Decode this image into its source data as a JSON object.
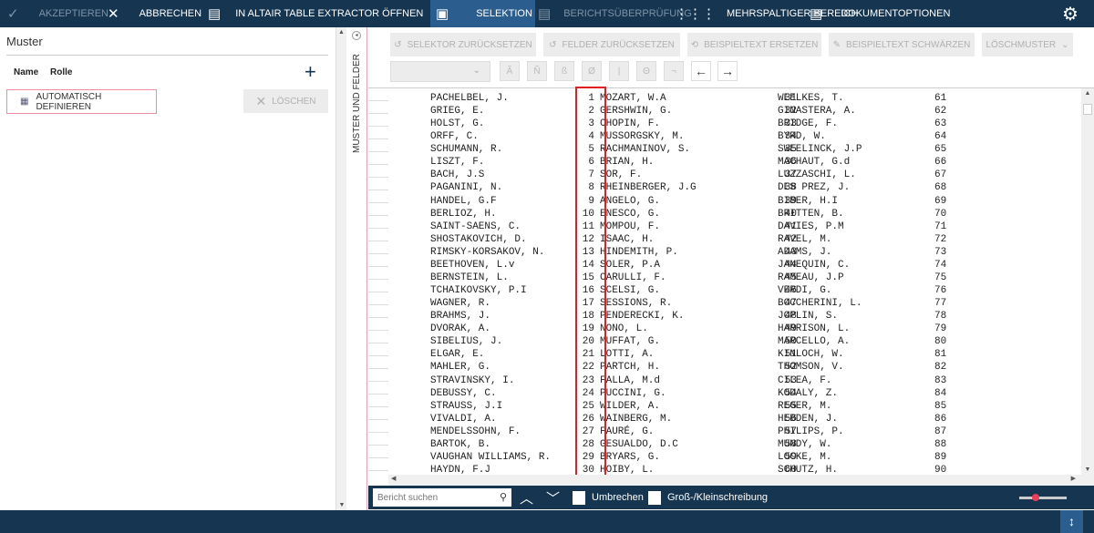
{
  "topbar": {
    "accept": "AKZEPTIEREN",
    "cancel": "ABBRECHEN",
    "open_extractor": "IN ALTAIR TABLE EXTRACTOR ÖFFNEN",
    "selection": "SELEKTION",
    "report_check": "BERICHTSÜBERPRÜFUNG",
    "multicolumn": "MEHRSPALTIGER BEREICH",
    "doc_options": "DOKUMENTOPTIONEN"
  },
  "left": {
    "title": "Muster",
    "col_name": "Name",
    "col_role": "Rolle",
    "auto_define": "AUTOMATISCH DEFINIEREN",
    "delete": "LÖSCHEN"
  },
  "vertical_tab": "MUSTER UND FELDER",
  "toolbar": {
    "reset_selector": "SELEKTOR ZURÜCKSETZEN",
    "reset_fields": "FELDER ZURÜCKSETZEN",
    "replace_sample": "BEISPIELTEXT ERSETZEN",
    "redact_sample": "BEISPIELTEXT SCHWÄRZEN",
    "delete_pattern": "LÖSCHMUSTER",
    "dropdown_value": "",
    "symbols": [
      "Ã",
      "Ñ",
      "ß",
      "Ø",
      "|",
      "Θ",
      "¬"
    ],
    "arrow_left": "←",
    "arrow_right": "→"
  },
  "document": {
    "rows": [
      [
        "PACHELBEL, J.",
        "1",
        "MOZART, W.A",
        "31",
        "WEELKES, T.",
        "61"
      ],
      [
        "GRIEG, E.",
        "2",
        "GERSHWIN, G.",
        "32",
        "GINASTERA, A.",
        "62"
      ],
      [
        "HOLST, G.",
        "3",
        "CHOPIN, F.",
        "33",
        "BRIDGE, F.",
        "63"
      ],
      [
        "ORFF, C.",
        "4",
        "MUSSORGSKY, M.",
        "34",
        "BYRD, W.",
        "64"
      ],
      [
        "SCHUMANN, R.",
        "5",
        "RACHMANINOV, S.",
        "35",
        "SWEELINCK, J.P",
        "65"
      ],
      [
        "LISZT, F.",
        "6",
        "BRIAN, H.",
        "36",
        "MACHAUT, G.d",
        "66"
      ],
      [
        "BACH, J.S",
        "7",
        "SOR, F.",
        "37",
        "LUZZASCHI, L.",
        "67"
      ],
      [
        "PAGANINI, N.",
        "8",
        "RHEINBERGER, J.G",
        "38",
        "DES PREZ, J.",
        "68"
      ],
      [
        "HANDEL, G.F",
        "9",
        "ANGELO, G.",
        "39",
        "BIBER, H.I",
        "69"
      ],
      [
        "BERLIOZ, H.",
        "10",
        "ENESCO, G.",
        "40",
        "BRITTEN, B.",
        "70"
      ],
      [
        "SAINT-SAENS, C.",
        "11",
        "MOMPOU, F.",
        "41",
        "DAVIES, P.M",
        "71"
      ],
      [
        "SHOSTAKOVICH, D.",
        "12",
        "ISAAC, H.",
        "42",
        "RAVEL, M.",
        "72"
      ],
      [
        "RIMSKY-KORSAKOV, N.",
        "13",
        "HINDEMITH, P.",
        "43",
        "ADAMS, J.",
        "73"
      ],
      [
        "BEETHOVEN, L.v",
        "14",
        "SOLER, P.A",
        "44",
        "JANEQUIN, C.",
        "74"
      ],
      [
        "BERNSTEIN, L.",
        "15",
        "CARULLI, F.",
        "45",
        "RAMEAU, J.P",
        "75"
      ],
      [
        "TCHAIKOVSKY, P.I",
        "16",
        "SCELSI, G.",
        "46",
        "VERDI, G.",
        "76"
      ],
      [
        "WAGNER, R.",
        "17",
        "SESSIONS, R.",
        "47",
        "BOCCHERINI, L.",
        "77"
      ],
      [
        "BRAHMS, J.",
        "18",
        "PENDERECKI, K.",
        "48",
        "JOPLIN, S.",
        "78"
      ],
      [
        "DVORAK, A.",
        "19",
        "NONO, L.",
        "49",
        "HARRISON, L.",
        "79"
      ],
      [
        "SIBELIUS, J.",
        "20",
        "MUFFAT, G.",
        "50",
        "MARCELLO, A.",
        "80"
      ],
      [
        "ELGAR, E.",
        "21",
        "LOTTI, A.",
        "51",
        "KINLOCH, W.",
        "81"
      ],
      [
        "MAHLER, G.",
        "22",
        "PARTCH, H.",
        "52",
        "THOMSON, V.",
        "82"
      ],
      [
        "STRAVINSKY, I.",
        "23",
        "FALLA, M.d",
        "53",
        "CILEA, F.",
        "83"
      ],
      [
        "DEBUSSY, C.",
        "24",
        "PUCCINI, G.",
        "54",
        "KODALY, Z.",
        "84"
      ],
      [
        "STRAUSS, J.I",
        "25",
        "WILDER, A.",
        "55",
        "REGER, M.",
        "85"
      ],
      [
        "VIVALDI, A.",
        "26",
        "WAINBERG, M.",
        "56",
        "HEBDEN, J.",
        "86"
      ],
      [
        "MENDELSSOHN, F.",
        "27",
        "FAURÉ, G.",
        "57",
        "PHILIPS, P.",
        "87"
      ],
      [
        "BARTOK, B.",
        "28",
        "GESUALDO, D.C",
        "58",
        "MUNDY, W.",
        "88"
      ],
      [
        "VAUGHAN WILLIAMS, R.",
        "29",
        "BRYARS, G.",
        "59",
        "LOCKE, M.",
        "89"
      ],
      [
        "HAYDN, F.J",
        "30",
        "HOIBY, L.",
        "60",
        "SCHUTZ, H.",
        "90"
      ]
    ]
  },
  "bottombar": {
    "search_placeholder": "Bericht suchen",
    "wrap": "Umbrechen",
    "case": "Groß-/Kleinschreibung",
    "zoom_level": 0.35
  },
  "colors": {
    "header": "#163550",
    "selected_tab": "#2b5e8e",
    "highlight": "#e02020",
    "slider": "#e8405a"
  }
}
